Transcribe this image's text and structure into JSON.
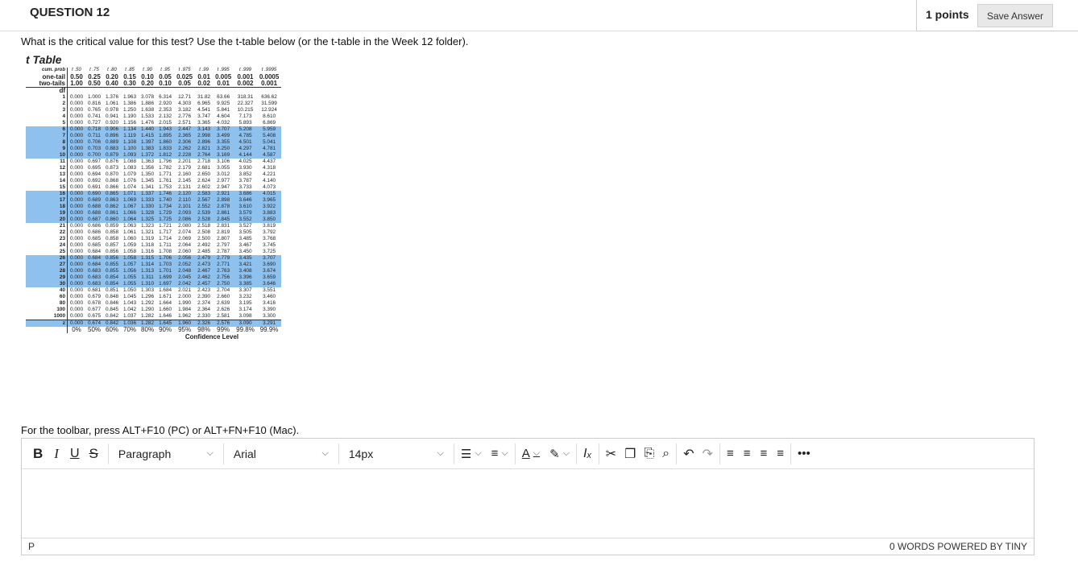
{
  "question": {
    "title": "QUESTION 12",
    "points": "1 points",
    "save_label": "Save Answer",
    "prompt": "What is the critical value for this test? Use the t-table below (or the t-table in the Week 12 folder)."
  },
  "t_table": {
    "title": "t Table",
    "subscripts": [
      "t.50",
      "t.75",
      "t.80",
      "t.85",
      "t.90",
      "t.95",
      "t.975",
      "t.99",
      "t.995",
      "t.999",
      "t.9995"
    ],
    "row_labels": {
      "cum_prob": "cum. prob",
      "one_tail": "one-tail",
      "two_tails": "two-tails",
      "df": "df",
      "z": "z"
    },
    "cum_prob": [
      "t .50",
      "t .75",
      "t .80",
      "t .85",
      "t .90",
      "t .95",
      "t .975",
      "t .99",
      "t .995",
      "t .999",
      "t .9995"
    ],
    "one_tail": [
      "0.50",
      "0.25",
      "0.20",
      "0.15",
      "0.10",
      "0.05",
      "0.025",
      "0.01",
      "0.005",
      "0.001",
      "0.0005"
    ],
    "two_tails": [
      "1.00",
      "0.50",
      "0.40",
      "0.30",
      "0.20",
      "0.10",
      "0.05",
      "0.02",
      "0.01",
      "0.002",
      "0.001"
    ],
    "rows": [
      {
        "df": "1",
        "v": [
          "0.000",
          "1.000",
          "1.376",
          "1.963",
          "3.078",
          "6.314",
          "12.71",
          "31.82",
          "63.66",
          "318.31",
          "636.62"
        ]
      },
      {
        "df": "2",
        "v": [
          "0.000",
          "0.816",
          "1.061",
          "1.386",
          "1.886",
          "2.920",
          "4.303",
          "6.965",
          "9.925",
          "22.327",
          "31.599"
        ]
      },
      {
        "df": "3",
        "v": [
          "0.000",
          "0.765",
          "0.978",
          "1.250",
          "1.638",
          "2.353",
          "3.182",
          "4.541",
          "5.841",
          "10.215",
          "12.924"
        ]
      },
      {
        "df": "4",
        "v": [
          "0.000",
          "0.741",
          "0.941",
          "1.190",
          "1.533",
          "2.132",
          "2.776",
          "3.747",
          "4.604",
          "7.173",
          "8.610"
        ]
      },
      {
        "df": "5",
        "v": [
          "0.000",
          "0.727",
          "0.920",
          "1.156",
          "1.476",
          "2.015",
          "2.571",
          "3.365",
          "4.032",
          "5.893",
          "6.869"
        ]
      },
      {
        "df": "6",
        "v": [
          "0.000",
          "0.718",
          "0.906",
          "1.134",
          "1.440",
          "1.943",
          "2.447",
          "3.143",
          "3.707",
          "5.208",
          "5.959"
        ]
      },
      {
        "df": "7",
        "v": [
          "0.000",
          "0.711",
          "0.896",
          "1.119",
          "1.415",
          "1.895",
          "2.365",
          "2.998",
          "3.499",
          "4.785",
          "5.408"
        ]
      },
      {
        "df": "8",
        "v": [
          "0.000",
          "0.706",
          "0.889",
          "1.108",
          "1.397",
          "1.860",
          "2.306",
          "2.896",
          "3.355",
          "4.501",
          "5.041"
        ]
      },
      {
        "df": "9",
        "v": [
          "0.000",
          "0.703",
          "0.883",
          "1.100",
          "1.383",
          "1.833",
          "2.262",
          "2.821",
          "3.250",
          "4.297",
          "4.781"
        ]
      },
      {
        "df": "10",
        "v": [
          "0.000",
          "0.700",
          "0.879",
          "1.093",
          "1.372",
          "1.812",
          "2.228",
          "2.764",
          "3.169",
          "4.144",
          "4.587"
        ]
      },
      {
        "df": "11",
        "v": [
          "0.000",
          "0.697",
          "0.876",
          "1.088",
          "1.363",
          "1.796",
          "2.201",
          "2.718",
          "3.106",
          "4.025",
          "4.437"
        ]
      },
      {
        "df": "12",
        "v": [
          "0.000",
          "0.695",
          "0.873",
          "1.083",
          "1.356",
          "1.782",
          "2.179",
          "2.681",
          "3.055",
          "3.930",
          "4.318"
        ]
      },
      {
        "df": "13",
        "v": [
          "0.000",
          "0.694",
          "0.870",
          "1.079",
          "1.350",
          "1.771",
          "2.160",
          "2.650",
          "3.012",
          "3.852",
          "4.221"
        ]
      },
      {
        "df": "14",
        "v": [
          "0.000",
          "0.692",
          "0.868",
          "1.076",
          "1.345",
          "1.761",
          "2.145",
          "2.624",
          "2.977",
          "3.787",
          "4.140"
        ]
      },
      {
        "df": "15",
        "v": [
          "0.000",
          "0.691",
          "0.866",
          "1.074",
          "1.341",
          "1.753",
          "2.131",
          "2.602",
          "2.947",
          "3.733",
          "4.073"
        ]
      },
      {
        "df": "16",
        "v": [
          "0.000",
          "0.690",
          "0.865",
          "1.071",
          "1.337",
          "1.746",
          "2.120",
          "2.583",
          "2.921",
          "3.686",
          "4.015"
        ]
      },
      {
        "df": "17",
        "v": [
          "0.000",
          "0.689",
          "0.863",
          "1.069",
          "1.333",
          "1.740",
          "2.110",
          "2.567",
          "2.898",
          "3.646",
          "3.965"
        ]
      },
      {
        "df": "18",
        "v": [
          "0.000",
          "0.688",
          "0.862",
          "1.067",
          "1.330",
          "1.734",
          "2.101",
          "2.552",
          "2.878",
          "3.610",
          "3.922"
        ]
      },
      {
        "df": "19",
        "v": [
          "0.000",
          "0.688",
          "0.861",
          "1.066",
          "1.328",
          "1.729",
          "2.093",
          "2.539",
          "2.861",
          "3.579",
          "3.883"
        ]
      },
      {
        "df": "20",
        "v": [
          "0.000",
          "0.687",
          "0.860",
          "1.064",
          "1.325",
          "1.725",
          "2.086",
          "2.528",
          "2.845",
          "3.552",
          "3.850"
        ]
      },
      {
        "df": "21",
        "v": [
          "0.000",
          "0.686",
          "0.859",
          "1.063",
          "1.323",
          "1.721",
          "2.080",
          "2.518",
          "2.831",
          "3.527",
          "3.819"
        ]
      },
      {
        "df": "22",
        "v": [
          "0.000",
          "0.686",
          "0.858",
          "1.061",
          "1.321",
          "1.717",
          "2.074",
          "2.508",
          "2.819",
          "3.505",
          "3.792"
        ]
      },
      {
        "df": "23",
        "v": [
          "0.000",
          "0.685",
          "0.858",
          "1.060",
          "1.319",
          "1.714",
          "2.069",
          "2.500",
          "2.807",
          "3.485",
          "3.768"
        ]
      },
      {
        "df": "24",
        "v": [
          "0.000",
          "0.685",
          "0.857",
          "1.059",
          "1.318",
          "1.711",
          "2.064",
          "2.492",
          "2.797",
          "3.467",
          "3.745"
        ]
      },
      {
        "df": "25",
        "v": [
          "0.000",
          "0.684",
          "0.856",
          "1.058",
          "1.316",
          "1.708",
          "2.060",
          "2.485",
          "2.787",
          "3.450",
          "3.725"
        ]
      },
      {
        "df": "26",
        "v": [
          "0.000",
          "0.684",
          "0.856",
          "1.058",
          "1.315",
          "1.706",
          "2.056",
          "2.479",
          "2.779",
          "3.435",
          "3.707"
        ]
      },
      {
        "df": "27",
        "v": [
          "0.000",
          "0.684",
          "0.855",
          "1.057",
          "1.314",
          "1.703",
          "2.052",
          "2.473",
          "2.771",
          "3.421",
          "3.690"
        ]
      },
      {
        "df": "28",
        "v": [
          "0.000",
          "0.683",
          "0.855",
          "1.056",
          "1.313",
          "1.701",
          "2.048",
          "2.467",
          "2.763",
          "3.408",
          "3.674"
        ]
      },
      {
        "df": "29",
        "v": [
          "0.000",
          "0.683",
          "0.854",
          "1.055",
          "1.311",
          "1.699",
          "2.045",
          "2.462",
          "2.756",
          "3.396",
          "3.659"
        ]
      },
      {
        "df": "30",
        "v": [
          "0.000",
          "0.683",
          "0.854",
          "1.055",
          "1.310",
          "1.697",
          "2.042",
          "2.457",
          "2.750",
          "3.385",
          "3.646"
        ]
      },
      {
        "df": "40",
        "v": [
          "0.000",
          "0.681",
          "0.851",
          "1.050",
          "1.303",
          "1.684",
          "2.021",
          "2.423",
          "2.704",
          "3.307",
          "3.551"
        ]
      },
      {
        "df": "60",
        "v": [
          "0.000",
          "0.679",
          "0.848",
          "1.045",
          "1.296",
          "1.671",
          "2.000",
          "2.390",
          "2.660",
          "3.232",
          "3.460"
        ]
      },
      {
        "df": "80",
        "v": [
          "0.000",
          "0.678",
          "0.846",
          "1.043",
          "1.292",
          "1.664",
          "1.990",
          "2.374",
          "2.639",
          "3.195",
          "3.416"
        ]
      },
      {
        "df": "100",
        "v": [
          "0.000",
          "0.677",
          "0.845",
          "1.042",
          "1.290",
          "1.660",
          "1.984",
          "2.364",
          "2.626",
          "3.174",
          "3.390"
        ]
      },
      {
        "df": "1000",
        "v": [
          "0.000",
          "0.675",
          "0.842",
          "1.037",
          "1.282",
          "1.646",
          "1.962",
          "2.330",
          "2.581",
          "3.098",
          "3.300"
        ]
      }
    ],
    "highlight_rows": [
      "6",
      "7",
      "8",
      "9",
      "10",
      "16",
      "17",
      "18",
      "19",
      "20",
      "26",
      "27",
      "28",
      "29",
      "30"
    ],
    "z_row": [
      "0.000",
      "0.674",
      "0.842",
      "1.036",
      "1.282",
      "1.645",
      "1.960",
      "2.326",
      "2.576",
      "3.090",
      "3.291"
    ],
    "confidence": [
      "0%",
      "50%",
      "60%",
      "70%",
      "80%",
      "90%",
      "95%",
      "98%",
      "99%",
      "99.8%",
      "99.9%"
    ],
    "confidence_label": "Confidence Level",
    "highlight_color": "#8fc1ee"
  },
  "editor": {
    "hint": "For the toolbar, press ALT+F10 (PC) or ALT+FN+F10 (Mac).",
    "bold": "B",
    "italic": "I",
    "underline": "U",
    "strike": "S",
    "block_format": "Paragraph",
    "font_family": "Arial",
    "font_size": "14px",
    "path": "P",
    "word_count": "0 WORDS",
    "powered_by": "POWERED BY TINY"
  }
}
